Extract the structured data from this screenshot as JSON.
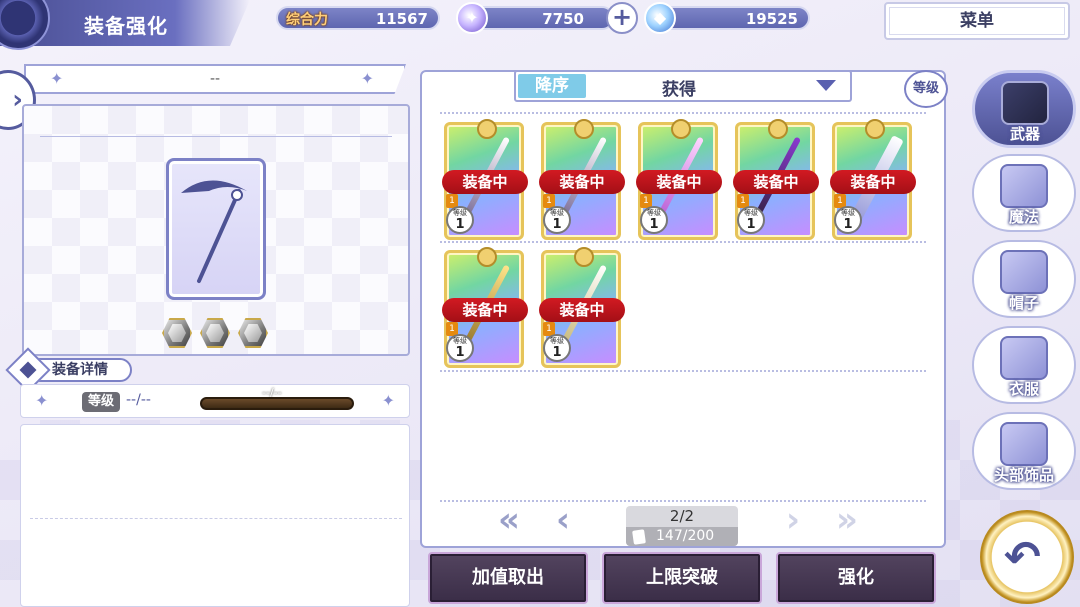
{
  "header": {
    "title": "装备强化",
    "power_label": "综合力",
    "power_value": "11567",
    "gem_value": "7750",
    "plus_symbol": "+",
    "potion_value": "19525",
    "menu_label": "菜单"
  },
  "left_panel": {
    "nav_arrow": "›",
    "item_name": "--",
    "detail_label": "装备详情",
    "level_label": "等级",
    "level_value": "--/--",
    "exp_text": "--/--",
    "sparkle": "✦",
    "rank_gems": 3
  },
  "list": {
    "sort_order": "降序",
    "sort_value": "获得",
    "level_sort_button": "等级",
    "items": [
      {
        "status": "装备中",
        "level_caption": "等级",
        "level": "1",
        "rank": "1"
      },
      {
        "status": "装备中",
        "level_caption": "等级",
        "level": "1",
        "rank": "1"
      },
      {
        "status": "装备中",
        "level_caption": "等级",
        "level": "1",
        "rank": "1"
      },
      {
        "status": "装备中",
        "level_caption": "等级",
        "level": "1",
        "rank": "1"
      },
      {
        "status": "装备中",
        "level_caption": "等级",
        "level": "1",
        "rank": "1"
      },
      {
        "status": "装备中",
        "level_caption": "等级",
        "level": "1",
        "rank": "1"
      },
      {
        "status": "装备中",
        "level_caption": "等级",
        "level": "1",
        "rank": "1"
      }
    ]
  },
  "pager": {
    "first": "«",
    "prev": "‹",
    "next": "›",
    "last": "»",
    "page": "2/2",
    "count": "147/200"
  },
  "actions": {
    "withdraw": "加值取出",
    "breakthrough": "上限突破",
    "enhance": "强化"
  },
  "categories": [
    {
      "label": "武器",
      "active": true
    },
    {
      "label": "魔法",
      "active": false
    },
    {
      "label": "帽子",
      "active": false
    },
    {
      "label": "衣服",
      "active": false
    },
    {
      "label": "头部饰品",
      "active": false
    }
  ],
  "back_symbol": "↶",
  "colors": {
    "accent": "#4d5294",
    "equipped_badge": "#d21a22",
    "action_button": "#3a2d47",
    "sort_active": "#7fcbe8"
  }
}
